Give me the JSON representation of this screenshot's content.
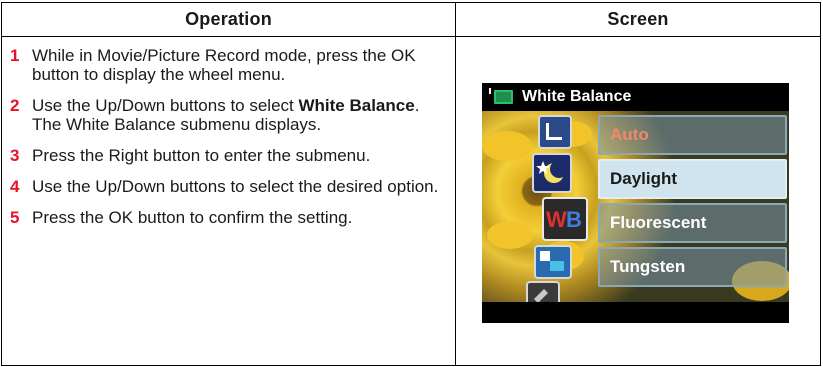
{
  "table": {
    "header_operation": "Operation",
    "header_screen": "Screen"
  },
  "steps": [
    {
      "num": "1",
      "text": "While in Movie/Picture Record mode, press the OK button to display the wheel menu."
    },
    {
      "num": "2",
      "text_before": "Use the Up/Down buttons to select ",
      "bold": "White Balance",
      "text_after": ". The White Balance submenu displays."
    },
    {
      "num": "3",
      "text": "Press the Right button to enter the submenu."
    },
    {
      "num": "4",
      "text": "Use the Up/Down buttons to select the desired option."
    },
    {
      "num": "5",
      "text": "Press the OK button to confirm the setting."
    }
  ],
  "screen": {
    "title": "White Balance",
    "title_icon": "movie-camera-icon",
    "wheel_badge": "WB",
    "menu_items": [
      {
        "label": "Auto",
        "selected": false
      },
      {
        "label": "Daylight",
        "selected": true
      },
      {
        "label": "Fluorescent",
        "selected": false
      },
      {
        "label": "Tungsten",
        "selected": false
      }
    ]
  },
  "colors": {
    "step_number": "#e8102a",
    "auto_text": "#f08a6a",
    "selected_item_bg": "#cfe4ee"
  }
}
